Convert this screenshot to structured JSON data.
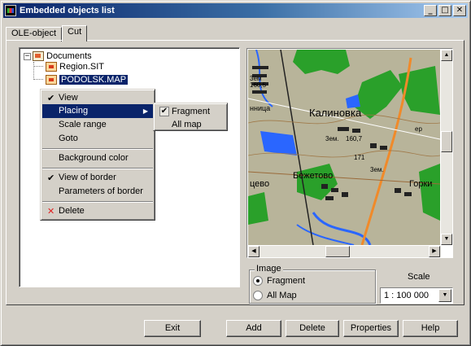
{
  "window": {
    "title": "Embedded objects list",
    "minimize": "_",
    "maximize": "□",
    "close": "✕"
  },
  "tabs": [
    {
      "label": "OLE-object"
    },
    {
      "label": "Cut"
    }
  ],
  "tree": {
    "root": "Documents",
    "children": [
      "Region.SIT",
      "PODOLSK.MAP"
    ],
    "selected": "PODOLSK.MAP"
  },
  "context_menu": {
    "items": [
      {
        "label": "View",
        "checked": true
      },
      {
        "label": "Placing",
        "highlighted": true,
        "submenu": true
      },
      {
        "label": "Scale range"
      },
      {
        "label": "Goto"
      },
      {
        "label": "Background color"
      },
      {
        "label": "View of border",
        "checked": true
      },
      {
        "label": "Parameters of border"
      },
      {
        "label": "Delete",
        "icon": "delete-x-icon"
      }
    ],
    "submenu": [
      {
        "label": "Fragment",
        "checked": true
      },
      {
        "label": "All map"
      }
    ]
  },
  "map": {
    "labels": {
      "kalinovka": "Калиновка",
      "bezhetovo": "Бежетово",
      "tsevo": "цево",
      "gorki": "Горки",
      "nnitsa": "нница",
      "zem1": "3ем",
      "zem2": "3ем.",
      "zem3": "3ем.",
      "elev1": "160,5",
      "elev2": "160,7",
      "elev3": "171",
      "ep": "ер"
    },
    "colors": {
      "background": "#b8b49a",
      "forest": "#2aa02a",
      "water": "#2a66ff",
      "road": "#f08a2a",
      "buildings": "#222222"
    }
  },
  "image_group": {
    "title": "Image",
    "options": [
      {
        "label": "Fragment",
        "checked": true
      },
      {
        "label": "All Map",
        "checked": false
      }
    ]
  },
  "scale": {
    "label": "Scale",
    "value": "1 : 100 000"
  },
  "buttons": {
    "exit": "Exit",
    "add": "Add",
    "delete": "Delete",
    "properties": "Properties",
    "help": "Help"
  }
}
